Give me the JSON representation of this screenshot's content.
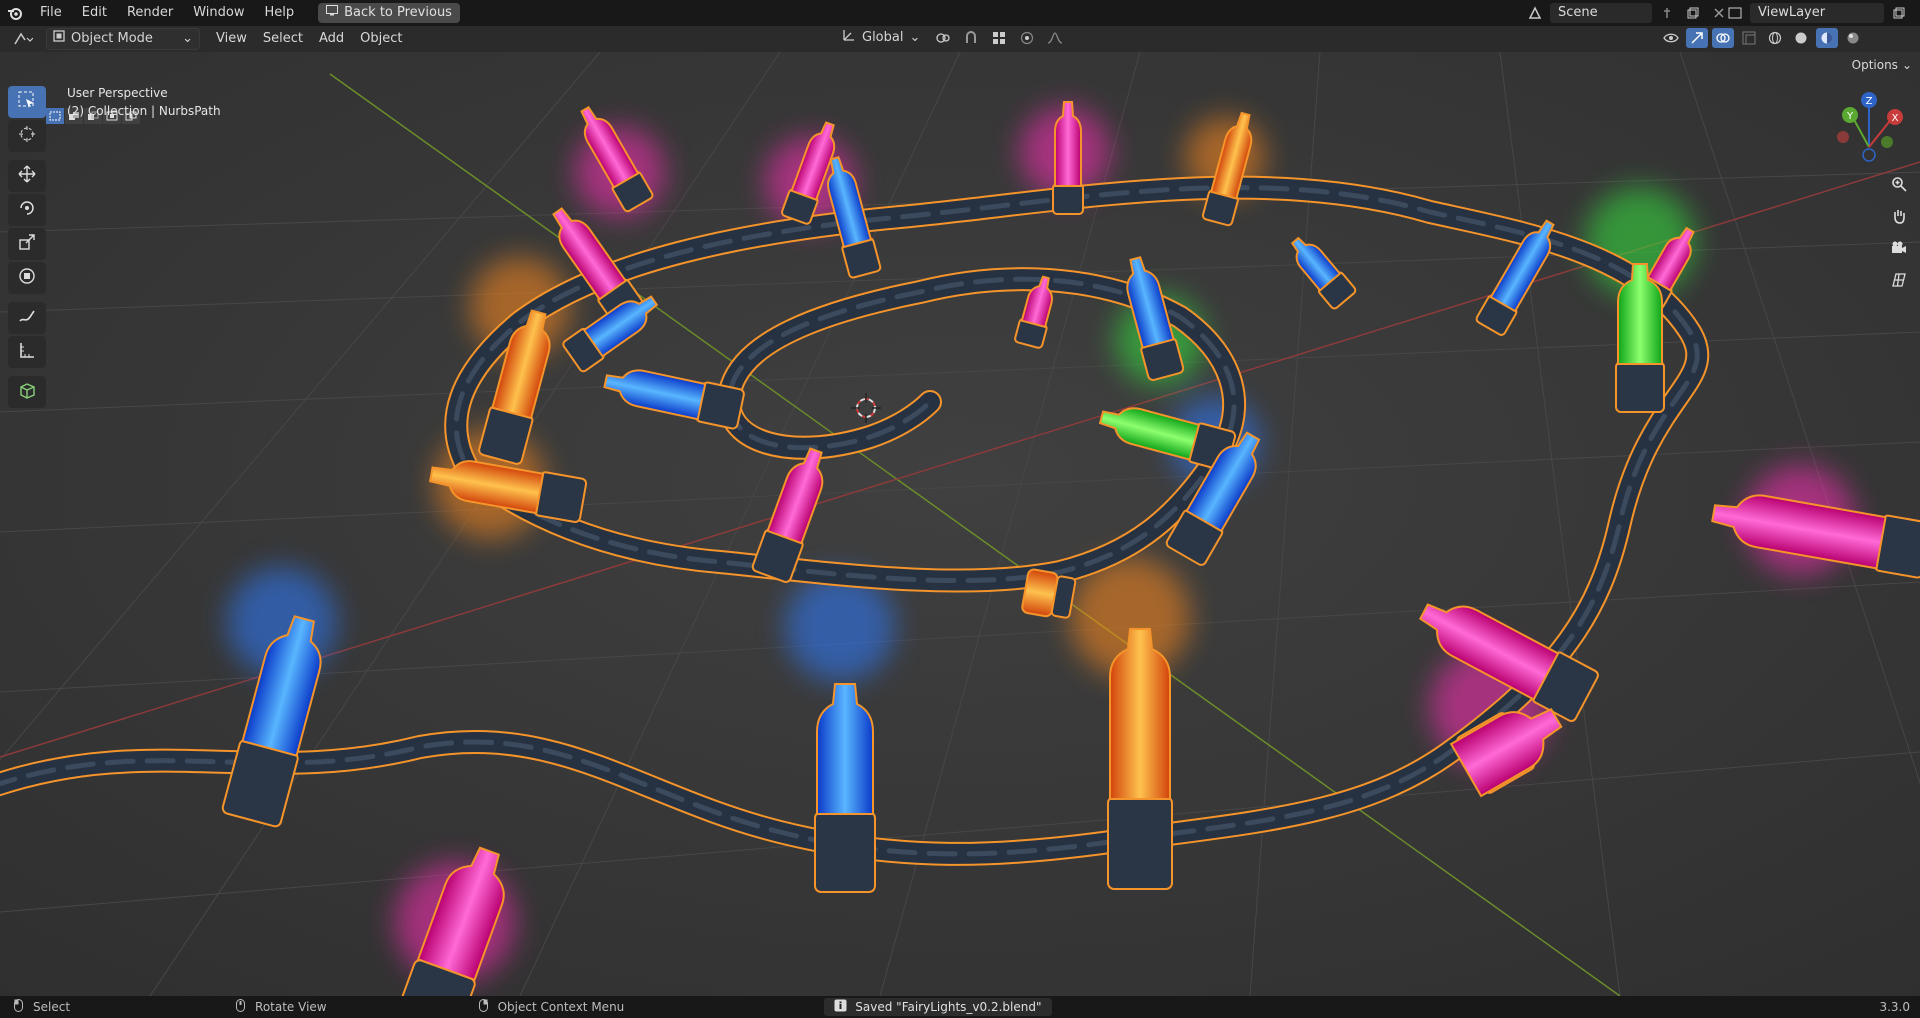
{
  "topbar": {
    "menus": [
      "File",
      "Edit",
      "Render",
      "Window",
      "Help"
    ],
    "back_label": "Back to Previous",
    "scene_name": "Scene",
    "view_layer": "ViewLayer"
  },
  "header": {
    "mode": "Object Mode",
    "menus": [
      "View",
      "Select",
      "Add",
      "Object"
    ],
    "orientation": "Global",
    "options_label": "Options"
  },
  "viewport": {
    "perspective": "User Perspective",
    "collection_info": "(2) Collection | NurbsPath",
    "gizmo_axes": [
      "Z",
      "Y",
      "X"
    ]
  },
  "statusbar": {
    "select_label": "Select",
    "rotate_label": "Rotate View",
    "context_label": "Object Context Menu",
    "message": "Saved \"FairyLights_v0.2.blend\"",
    "version": "3.3.0"
  },
  "colors": {
    "accent": "#4772b3",
    "selection_outline": "#f5942a",
    "bulb_blue": "#2f7bff",
    "bulb_pink": "#ff2fb7",
    "bulb_orange": "#ff8a1a",
    "bulb_green": "#35e33d"
  },
  "tools": [
    "select-box-icon",
    "cursor-icon",
    "move-icon",
    "rotate-icon",
    "scale-icon",
    "transform-icon",
    "annotate-icon",
    "measure-icon",
    "add-cube-icon"
  ]
}
